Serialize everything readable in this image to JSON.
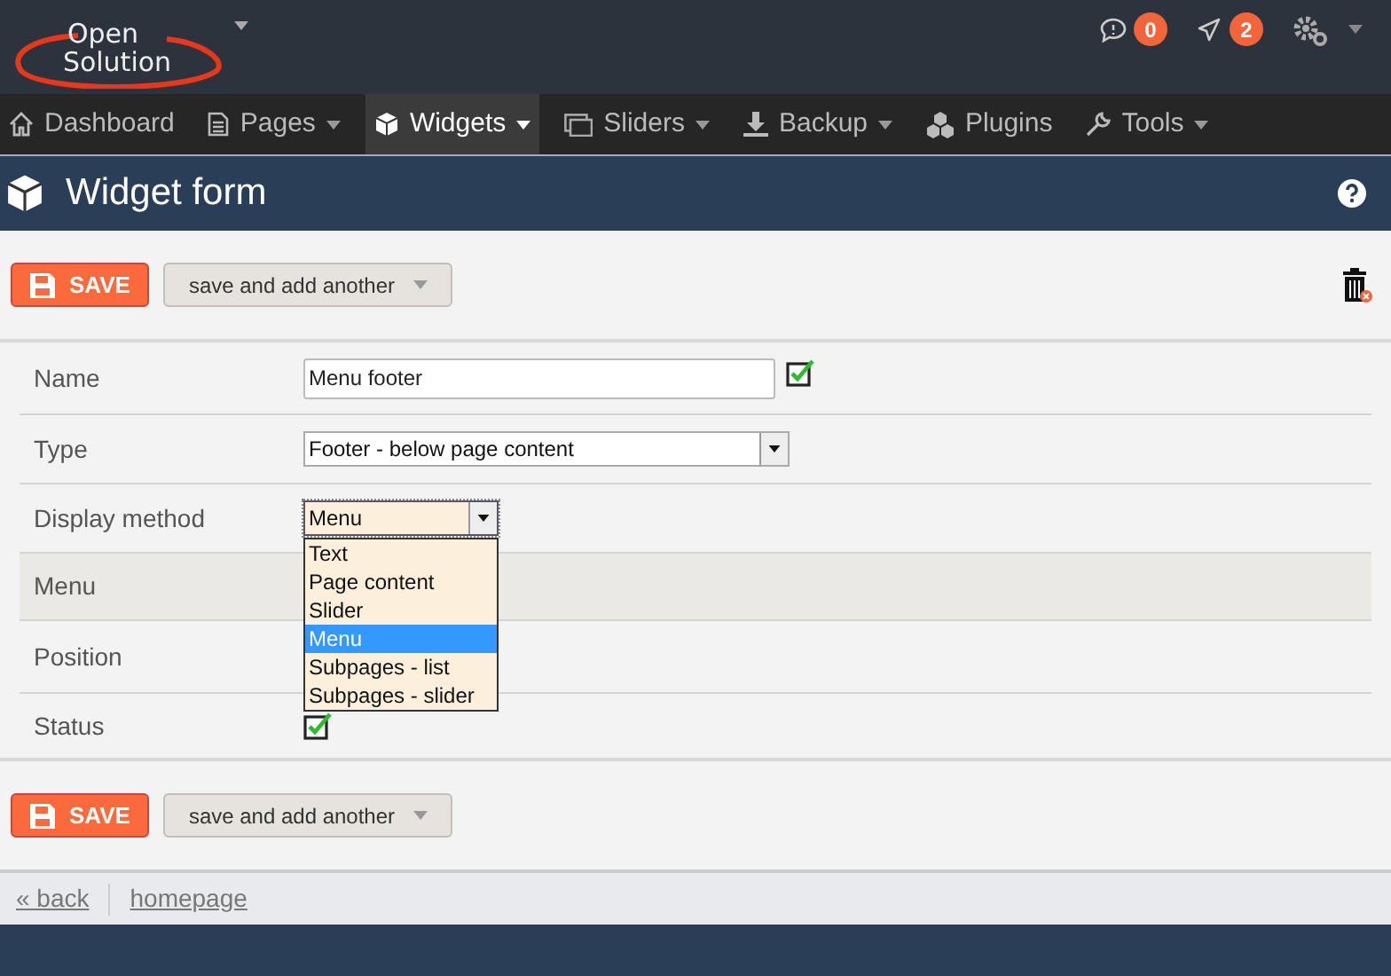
{
  "header": {
    "logo": {
      "line1": "Open",
      "line2": "Solution"
    },
    "notifications": [
      {
        "kind": "messages",
        "count": "0"
      },
      {
        "kind": "alerts",
        "count": "2"
      }
    ]
  },
  "nav": [
    {
      "label": "Dashboard",
      "dropdown": false,
      "selected": false
    },
    {
      "label": "Pages",
      "dropdown": true,
      "selected": false
    },
    {
      "label": "Widgets",
      "dropdown": true,
      "selected": true
    },
    {
      "label": "Sliders",
      "dropdown": true,
      "selected": false
    },
    {
      "label": "Backup",
      "dropdown": true,
      "selected": false
    },
    {
      "label": "Plugins",
      "dropdown": false,
      "selected": false
    },
    {
      "label": "Tools",
      "dropdown": true,
      "selected": false
    }
  ],
  "page_title": "Widget form",
  "top_toolbar": {
    "save": "SAVE",
    "save_another": "save and add another"
  },
  "form": [
    {
      "label": "Name",
      "kind": "text",
      "value": "Menu footer",
      "checked": true,
      "highlighted": false
    },
    {
      "label": "Type",
      "kind": "select",
      "value": "Footer - below page content",
      "highlighted": false
    },
    {
      "label": "Display method",
      "kind": "open_select",
      "value": "Menu",
      "highlighted": false,
      "options": [
        {
          "label": "Text",
          "selected": false
        },
        {
          "label": "Page content",
          "selected": false
        },
        {
          "label": "Slider",
          "selected": false
        },
        {
          "label": "Menu",
          "selected": true
        },
        {
          "label": "Subpages - list",
          "selected": false
        },
        {
          "label": "Subpages - slider",
          "selected": false
        }
      ]
    },
    {
      "label": "Menu",
      "kind": "covered",
      "highlighted": true
    },
    {
      "label": "Position",
      "kind": "covered",
      "highlighted": false
    },
    {
      "label": "Status",
      "kind": "checkbox",
      "checked": true,
      "highlighted": false
    }
  ],
  "bottom_toolbar": {
    "save": "SAVE",
    "save_another": "save and add another"
  },
  "footer_links": [
    "« back",
    "homepage"
  ]
}
